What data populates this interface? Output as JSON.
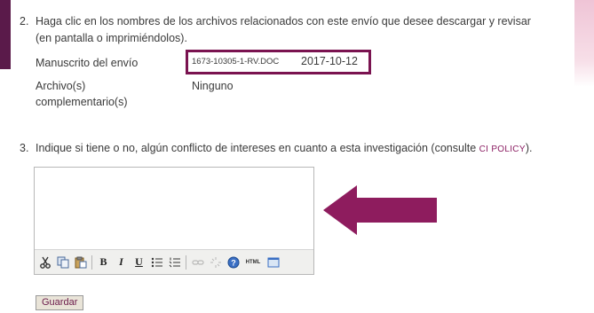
{
  "step2": {
    "number": "2.",
    "line1": "Haga clic en los nombres de los archivos relacionados con este envío que desee descargar y revisar",
    "line2": "(en pantalla o imprimiéndolos).",
    "manuscript_label": "Manuscrito del envío",
    "manuscript_file": "1673-10305-1-RV.DOC",
    "manuscript_date": "2017-10-12",
    "supplementary_label_1": "Archivo(s)",
    "supplementary_label_2": "complementario(s)",
    "supplementary_value": "Ninguno"
  },
  "step3": {
    "number": "3.",
    "text": "Indique si tiene o no, algún conflicto de intereses en cuanto a esta investigación (consulte ",
    "link": "CI POLICY",
    "suffix": ").",
    "editor_value": ""
  },
  "toolbar": {
    "bold": "B",
    "italic": "I",
    "underline": "U",
    "html": "HTML"
  },
  "save_label": "Guardar",
  "colors": {
    "highlight_border": "#7a1350",
    "arrow": "#8e1c5e",
    "link": "#8b1e63"
  }
}
